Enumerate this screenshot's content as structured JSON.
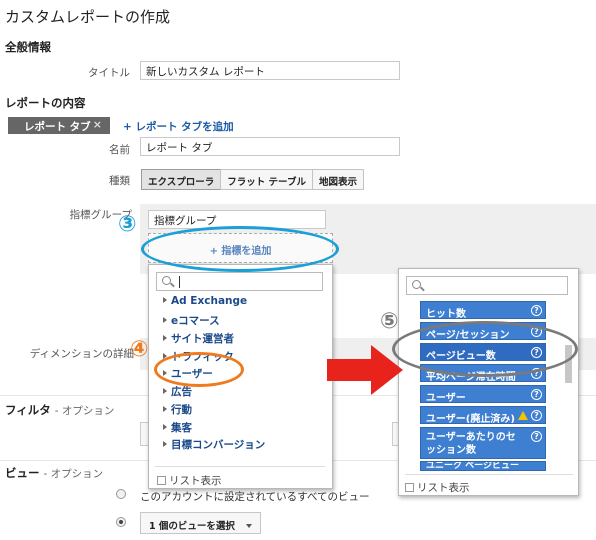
{
  "page_title": "カスタムレポートの作成",
  "general": {
    "heading": "全般情報",
    "title_label": "タイトル",
    "title_value": "新しいカスタム レポート"
  },
  "report_content": {
    "heading": "レポートの内容",
    "tab_chip": "レポート タブ",
    "tab_close": "×",
    "add_tab": "+ レポート タブを追加",
    "name_label": "名前",
    "name_value": "レポート タブ",
    "type_label": "種類",
    "types": [
      "エクスプローラ",
      "フラット テーブル",
      "地図表示"
    ],
    "metric_group_label": "指標グループ",
    "metric_group_value": "指標グループ",
    "add_metric": "+ 指標を追加",
    "dimension_label": "ディメンションの詳細"
  },
  "metric_popup": {
    "categories": [
      "Ad Exchange",
      "eコマース",
      "サイト運営者",
      "トラフィック",
      "ユーザー",
      "広告",
      "行動",
      "集客",
      "目標コンバージョン"
    ],
    "list_view": "リスト表示"
  },
  "metric_list_popup": {
    "items": [
      {
        "label": "ヒット数",
        "help": "?"
      },
      {
        "label": "ページ/セッション",
        "help": "?"
      },
      {
        "label": "ページビュー数",
        "help": "?"
      },
      {
        "label": "平均ページ滞在時間",
        "help": "?"
      },
      {
        "label": "ユーザー",
        "help": "?"
      },
      {
        "label": "ユーザー(廃止済み)",
        "help": "?"
      },
      {
        "label": "ユーザーあたりのセッション数",
        "help": ""
      },
      {
        "label": "ユニーク ページビュー",
        "help": ""
      }
    ],
    "list_view": "リスト表示"
  },
  "filter": {
    "heading": "フィルタ",
    "suffix": "- オプション"
  },
  "view": {
    "heading": "ビュー",
    "suffix": "- オプション",
    "option_all": "このアカウントに設定されているすべてのビュー",
    "option_one": "1 個のビューを選択"
  },
  "annotations": {
    "n3": "③",
    "n4": "④",
    "n5": "⑤"
  },
  "colors": {
    "accent_blue": "#3e7fd2",
    "annot_blue": "#1a9fd6",
    "annot_orange": "#f07a1e",
    "annot_gray": "#7a7a7a",
    "arrow_red": "#e8231b"
  }
}
